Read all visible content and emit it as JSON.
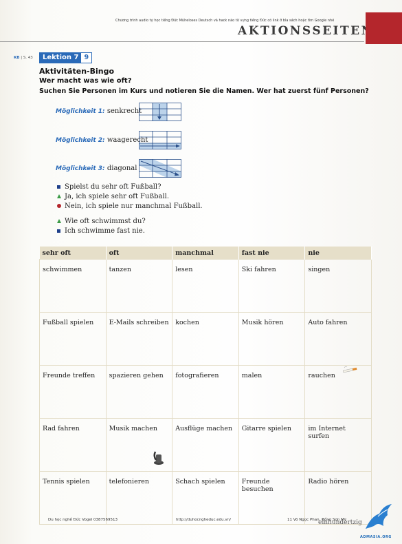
{
  "top_note": "Chương trình audio tự học tiếng Đức Müheloses Deutsch và hack não từ vựng tiếng Đức có link ở bìa sách hoặc tìm Google nhé",
  "header_title": "AKTIONSSEITEN",
  "reference": {
    "kb": "KB",
    "page": "| S. 43"
  },
  "lektion": {
    "label": "Lektion 7",
    "number": "9"
  },
  "heading": "Aktivitäten-Bingo",
  "subheading": "Wer macht was wie oft?",
  "instruction": "Suchen Sie Personen im Kurs und notieren Sie die Namen. Wer hat zuerst fünf Personen?",
  "options": [
    {
      "label": "Möglichkeit 1:",
      "text": "senkrecht"
    },
    {
      "label": "Möglichkeit 2:",
      "text": "waagerecht"
    },
    {
      "label": "Möglichkeit 3:",
      "text": "diagonal"
    }
  ],
  "dialogue": [
    {
      "marker": "square",
      "text": "Spielst du sehr oft Fußball?"
    },
    {
      "marker": "triangle",
      "text": "Ja, ich spiele sehr oft Fußball."
    },
    {
      "marker": "circle",
      "text": "Nein, ich spiele nur manchmal Fußball."
    },
    {
      "marker": "triangle",
      "text": "Wie oft schwimmst du?"
    },
    {
      "marker": "square",
      "text": "Ich schwimme fast nie."
    }
  ],
  "table": {
    "headers": [
      "sehr oft",
      "oft",
      "manchmal",
      "fast nie",
      "nie"
    ],
    "rows": [
      [
        "schwimmen",
        "tanzen",
        "lesen",
        "Ski fahren",
        "singen"
      ],
      [
        "Fußball spielen",
        "E-Mails schreiben",
        "kochen",
        "Musik hören",
        "Auto fahren"
      ],
      [
        "Freunde treffen",
        "spazieren gehen",
        "fotografieren",
        "malen",
        "rauchen"
      ],
      [
        "Rad fahren",
        "Musik machen",
        "Ausflüge machen",
        "Gitarre spielen",
        "im Internet surfen"
      ],
      [
        "Tennis spielen",
        "telefonieren",
        "Schach spielen",
        "Freunde besuchen",
        "Radio hören"
      ]
    ]
  },
  "footer": {
    "left": "Du học nghề Đức Vogel 0387569513",
    "center": "http://duhocngheduc.edu.vn/",
    "right": "11 Võ Ngọc Phan, Bồng Sơn Mỹ",
    "brand": "einhundertzig",
    "logo_text": "ADMASIA.ORG"
  },
  "colors": {
    "accent_blue": "#2a6ab8",
    "header_red": "#b4262c",
    "table_header": "#e6dfc9"
  }
}
